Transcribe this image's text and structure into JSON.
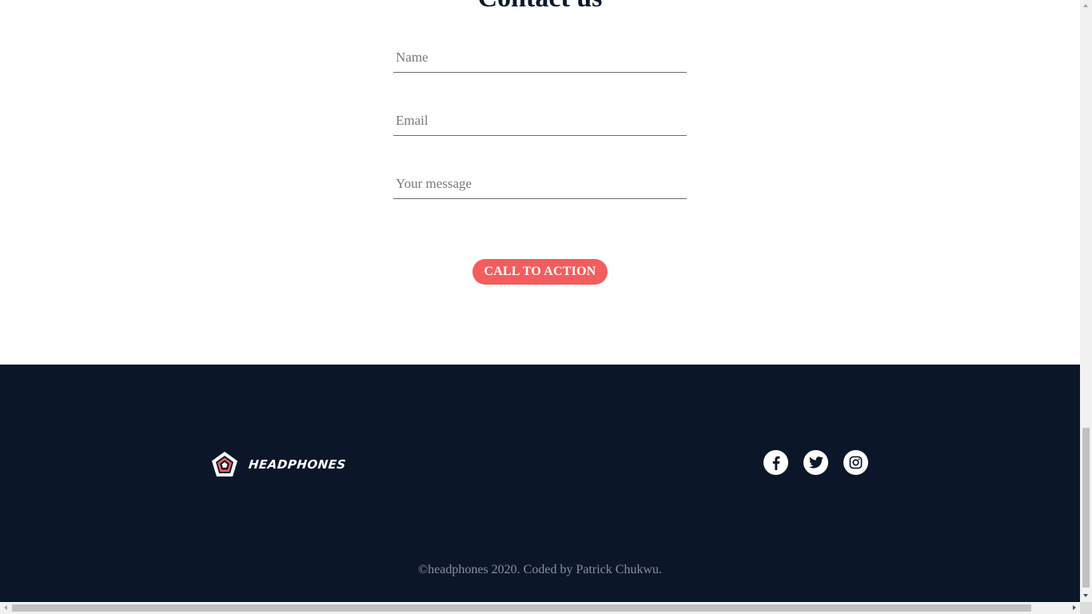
{
  "contact": {
    "title": "Contact us",
    "fields": {
      "name_placeholder": "Name",
      "email_placeholder": "Email",
      "message_placeholder": "Your message"
    },
    "cta_label": "CALL TO ACTION"
  },
  "footer": {
    "logo_text": "HEADPHONES",
    "social": [
      "facebook-icon",
      "twitter-icon",
      "instagram-icon"
    ],
    "copyright": "©headphones 2020. Coded by Patrick Chukwu."
  },
  "colors": {
    "accent": "#f45d5d",
    "footer_bg": "#0b1729",
    "title": "#0b1a2b"
  }
}
